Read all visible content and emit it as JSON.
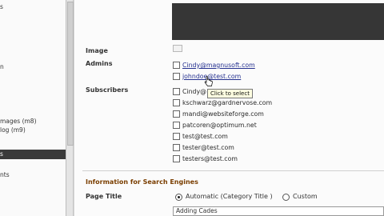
{
  "sidebar": {
    "items": [
      {
        "label": "s"
      },
      {
        "label": "n"
      },
      {
        "label": "mages (m8)"
      },
      {
        "label": "log (m9)"
      },
      {
        "label": "s"
      },
      {
        "label": "nts"
      }
    ]
  },
  "form": {
    "image_label": "Image",
    "admins_label": "Admins",
    "subscribers_label": "Subscribers",
    "admins": [
      "Cindy@magnusoft.com",
      "johndoe@test.com"
    ],
    "subscribers": [
      "Cindy@",
      "kschwarz@gardnervose.com",
      "mandi@websiteforge.com",
      "patcoren@optimum.net",
      "test@test.com",
      "tester@test.com",
      "testers@test.com"
    ],
    "tooltip": "Click to select",
    "seo_heading": "Information for Search Engines",
    "page_title_label": "Page Title",
    "radio_automatic": "Automatic (Category Title )",
    "radio_custom": "Custom",
    "page_title_value": "Adding Cades"
  }
}
